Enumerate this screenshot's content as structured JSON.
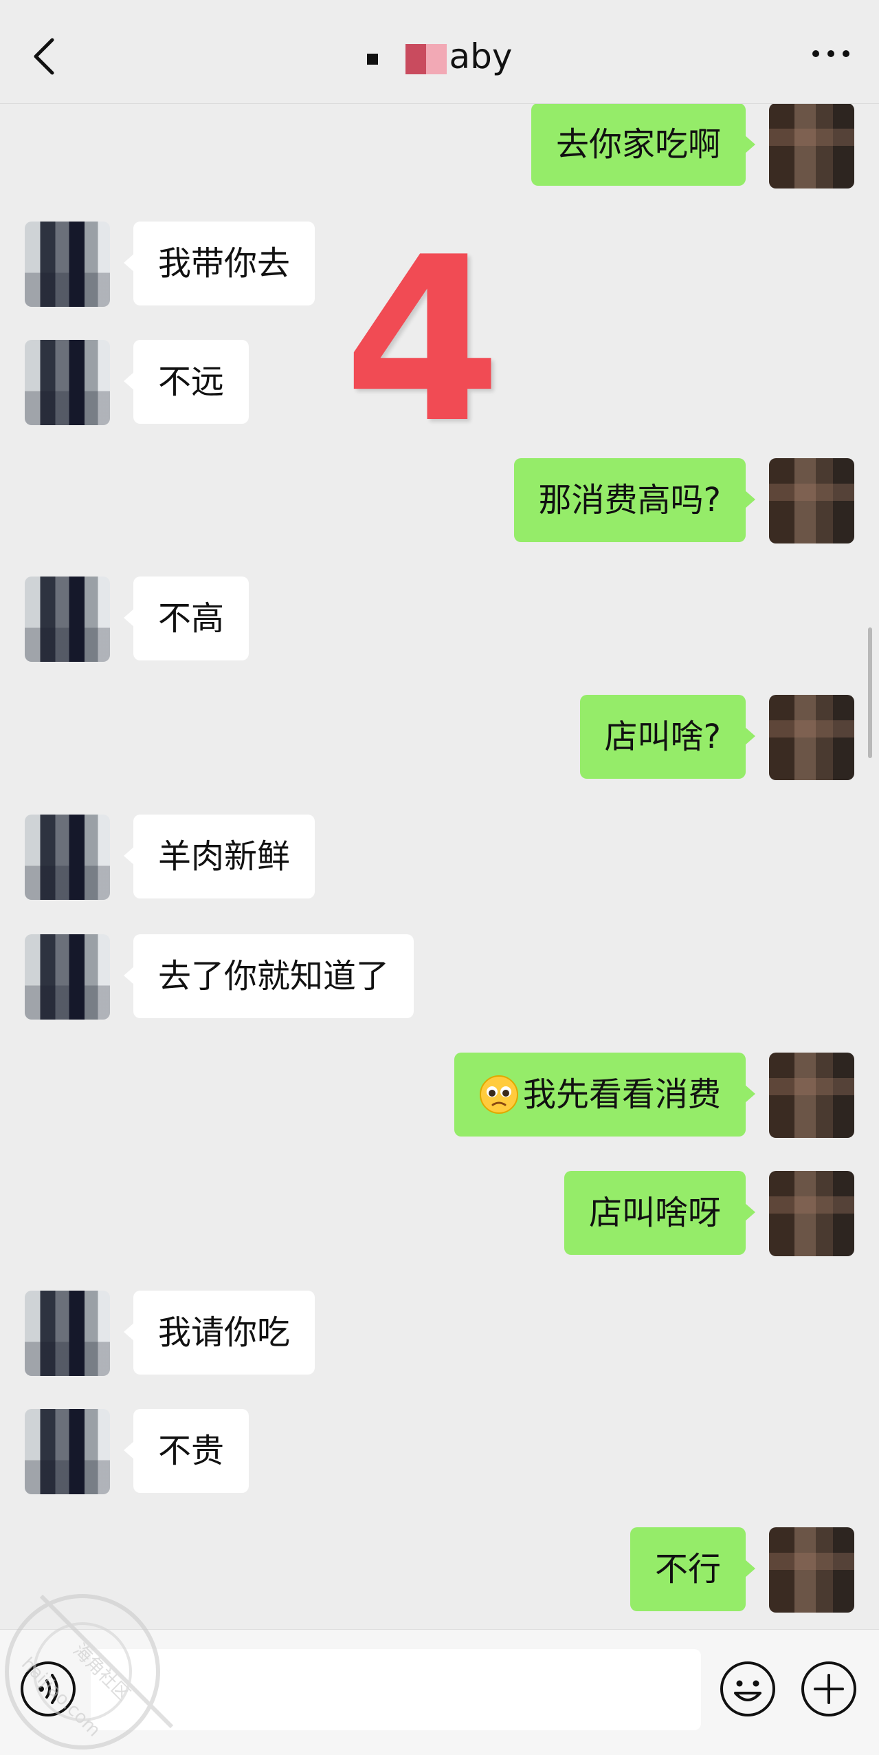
{
  "header": {
    "title": "aby",
    "back_icon": "chevron-left-icon",
    "more_icon": "ellipsis-icon"
  },
  "overlay": {
    "number": "4",
    "color": "#f14b54"
  },
  "messages": [
    {
      "side": "out",
      "text": "去你家吃啊"
    },
    {
      "side": "in",
      "text": "我带你去"
    },
    {
      "side": "in",
      "text": "不远"
    },
    {
      "side": "out",
      "text": "那消费高吗?"
    },
    {
      "side": "in",
      "text": "不高"
    },
    {
      "side": "out",
      "text": "店叫啥?"
    },
    {
      "side": "in",
      "text": "羊肉新鲜"
    },
    {
      "side": "in",
      "text": "去了你就知道了"
    },
    {
      "side": "out",
      "text": "我先看看消费",
      "emoji": "pleading-face-icon"
    },
    {
      "side": "out",
      "text": "店叫啥呀"
    },
    {
      "side": "in",
      "text": "我请你吃"
    },
    {
      "side": "in",
      "text": "不贵"
    },
    {
      "side": "out",
      "text": "不行"
    }
  ],
  "input_bar": {
    "voice_icon": "voice-icon",
    "emoji_icon": "smiley-icon",
    "plus_icon": "plus-circle-icon",
    "input_value": ""
  },
  "watermark": {
    "line1": "海角社区",
    "line2": "haijiao.com"
  },
  "colors": {
    "background": "#ededed",
    "outgoing_bubble": "#95ec69",
    "incoming_bubble": "#ffffff"
  }
}
